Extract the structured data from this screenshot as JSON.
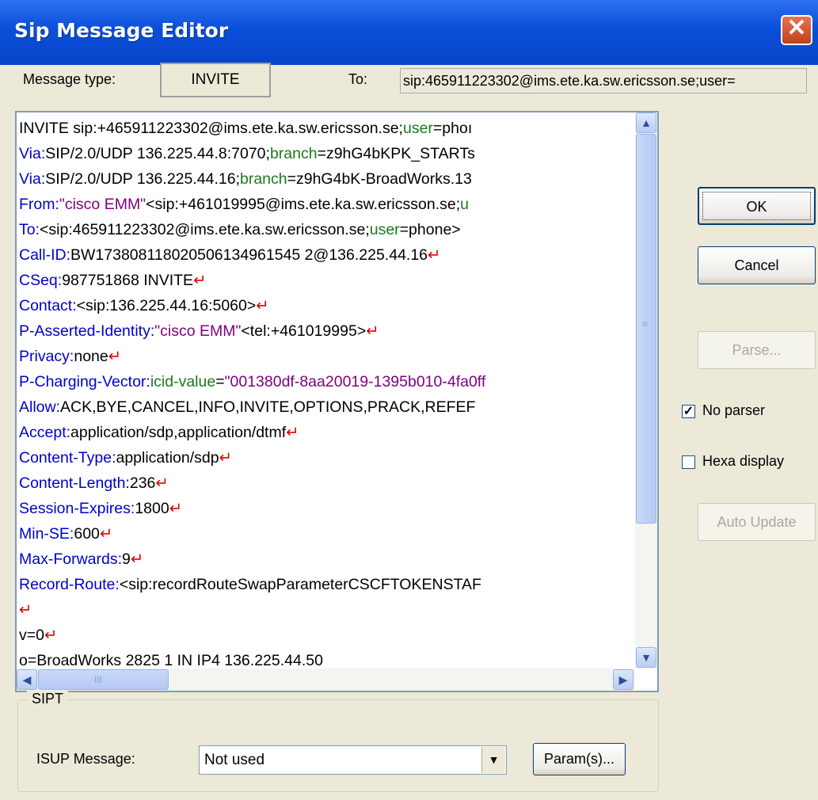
{
  "window": {
    "title": "Sip Message Editor",
    "close_glyph": "✕"
  },
  "header": {
    "message_type_label": "Message type:",
    "message_type_value": "INVITE",
    "to_label": "To:",
    "to_value": "sip:465911223302@ims.ete.ka.sw.ericsson.se;user="
  },
  "editor": {
    "lines": [
      [
        {
          "t": "INVITE sip:+465911223302@ims.ete.ka.sw.ericsson.se;",
          "c": ""
        },
        {
          "t": "user",
          "c": "pk"
        },
        {
          "t": "=phoı",
          "c": ""
        }
      ],
      [
        {
          "t": "Via:",
          "c": "hn"
        },
        {
          "t": "SIP/2.0/UDP 136.225.44.8:7070;",
          "c": ""
        },
        {
          "t": "branch",
          "c": "pk"
        },
        {
          "t": "=z9hG4bKPK_STARTs",
          "c": ""
        }
      ],
      [
        {
          "t": "Via:",
          "c": "hn"
        },
        {
          "t": "SIP/2.0/UDP 136.225.44.16;",
          "c": ""
        },
        {
          "t": "branch",
          "c": "pk"
        },
        {
          "t": "=z9hG4bK-BroadWorks.13",
          "c": ""
        }
      ],
      [
        {
          "t": "From:",
          "c": "hn"
        },
        {
          "t": "\"cisco EMM\"",
          "c": "qv"
        },
        {
          "t": "<sip:+461019995@ims.ete.ka.sw.ericsson.se;",
          "c": ""
        },
        {
          "t": "u",
          "c": "pk"
        }
      ],
      [
        {
          "t": "To:",
          "c": "hn"
        },
        {
          "t": "<sip:465911223302@ims.ete.ka.sw.ericsson.se;",
          "c": ""
        },
        {
          "t": "user",
          "c": "pk"
        },
        {
          "t": "=phone>",
          "c": ""
        }
      ],
      [
        {
          "t": "Call-ID:",
          "c": "hn"
        },
        {
          "t": "BW173808118020506134961545 2@136.225.44.16",
          "c": ""
        },
        {
          "t": "↵",
          "c": "cr"
        }
      ],
      [
        {
          "t": "CSeq:",
          "c": "hn"
        },
        {
          "t": "987751868 INVITE",
          "c": ""
        },
        {
          "t": "↵",
          "c": "cr"
        }
      ],
      [
        {
          "t": "Contact:",
          "c": "hn"
        },
        {
          "t": "<sip:136.225.44.16:5060>",
          "c": ""
        },
        {
          "t": "↵",
          "c": "cr"
        }
      ],
      [
        {
          "t": "P-Asserted-Identity:",
          "c": "hn"
        },
        {
          "t": "\"cisco EMM\"",
          "c": "qv"
        },
        {
          "t": "<tel:+461019995>",
          "c": ""
        },
        {
          "t": "↵",
          "c": "cr"
        }
      ],
      [
        {
          "t": "Privacy:",
          "c": "hn"
        },
        {
          "t": "none",
          "c": ""
        },
        {
          "t": "↵",
          "c": "cr"
        }
      ],
      [
        {
          "t": "P-Charging-Vector:",
          "c": "hn"
        },
        {
          "t": "icid-value",
          "c": "pk"
        },
        {
          "t": "=",
          "c": ""
        },
        {
          "t": "\"001380df-8aa20019-1395b010-4fa0ff",
          "c": "qv"
        }
      ],
      [
        {
          "t": "Allow:",
          "c": "hn"
        },
        {
          "t": "ACK,BYE,CANCEL,INFO,INVITE,OPTIONS,PRACK,REFEF",
          "c": ""
        }
      ],
      [
        {
          "t": "Accept:",
          "c": "hn"
        },
        {
          "t": "application/sdp,application/dtmf",
          "c": ""
        },
        {
          "t": "↵",
          "c": "cr"
        }
      ],
      [
        {
          "t": "Content-Type:",
          "c": "hn"
        },
        {
          "t": "application/sdp",
          "c": ""
        },
        {
          "t": "↵",
          "c": "cr"
        }
      ],
      [
        {
          "t": "Content-Length:",
          "c": "hn"
        },
        {
          "t": "236",
          "c": ""
        },
        {
          "t": "↵",
          "c": "cr"
        }
      ],
      [
        {
          "t": "Session-Expires:",
          "c": "hn"
        },
        {
          "t": "1800",
          "c": ""
        },
        {
          "t": "↵",
          "c": "cr"
        }
      ],
      [
        {
          "t": "Min-SE:",
          "c": "hn"
        },
        {
          "t": "600",
          "c": ""
        },
        {
          "t": "↵",
          "c": "cr"
        }
      ],
      [
        {
          "t": "Max-Forwards:",
          "c": "hn"
        },
        {
          "t": "9",
          "c": ""
        },
        {
          "t": "↵",
          "c": "cr"
        }
      ],
      [
        {
          "t": "Record-Route:",
          "c": "hn"
        },
        {
          "t": "<sip:recordRouteSwapParameterCSCFTOKENSTAF",
          "c": ""
        }
      ],
      [
        {
          "t": "↵",
          "c": "cr"
        }
      ],
      [
        {
          "t": "v=0",
          "c": ""
        },
        {
          "t": "↵",
          "c": "cr"
        }
      ],
      [
        {
          "t": "o=BroadWorks 2825 1 IN IP4 136.225.44.50",
          "c": ""
        }
      ]
    ]
  },
  "buttons": {
    "ok": "OK",
    "cancel": "Cancel",
    "parse": "Parse...",
    "auto_update": "Auto Update",
    "params": "Param(s)..."
  },
  "options": {
    "no_parser_label": "No parser",
    "no_parser_checked": "✓",
    "hexa_display_label": "Hexa display"
  },
  "sipt": {
    "group_label": "SIPT",
    "isup_label": "ISUP Message:",
    "isup_value": "Not used"
  },
  "icons": {
    "up": "▲",
    "down": "▼",
    "left": "◀",
    "right": "▶",
    "combo": "▼",
    "grip_v": "≡",
    "grip_h": "III"
  },
  "colors": {
    "header_name": "#0000cc",
    "param_key": "#1a7a1a",
    "quoted": "#800080",
    "line_break": "#e00000"
  }
}
